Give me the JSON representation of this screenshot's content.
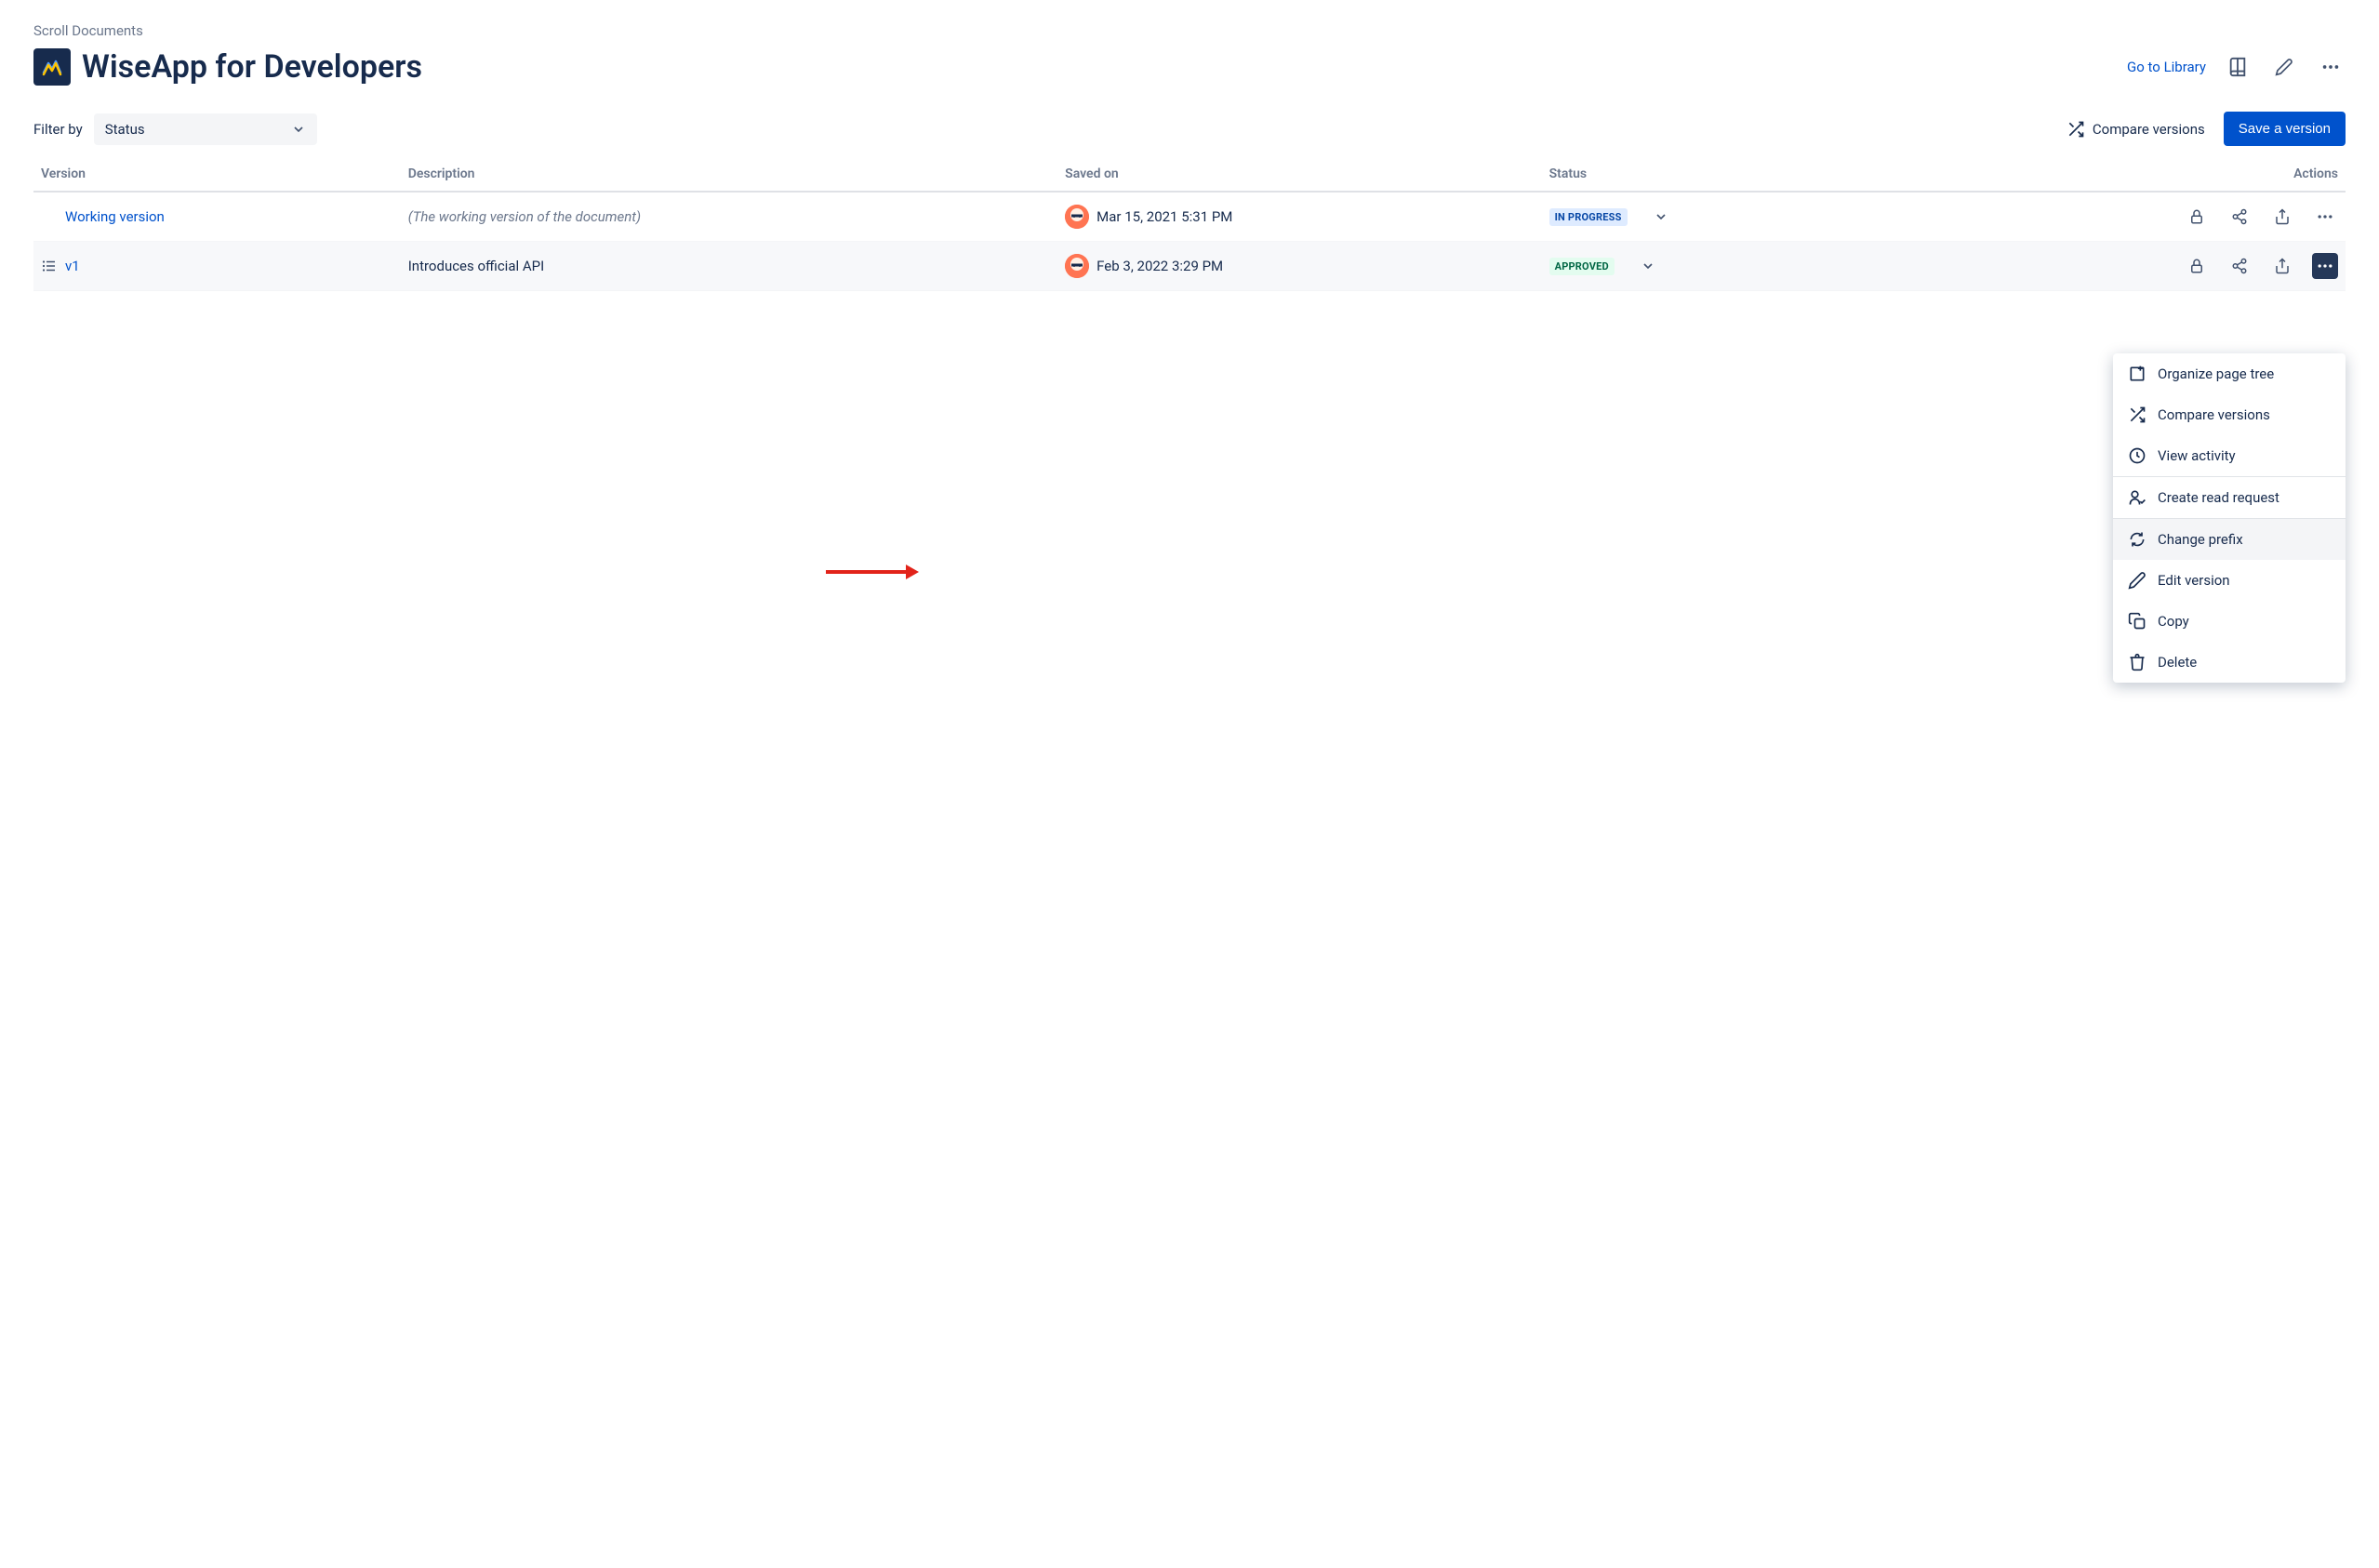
{
  "breadcrumb": "Scroll Documents",
  "page_title": "WiseApp for Developers",
  "header": {
    "go_to_library": "Go to Library"
  },
  "toolbar": {
    "filter_label": "Filter by",
    "status_select": "Status",
    "compare_label": "Compare versions",
    "save_label": "Save a version"
  },
  "table": {
    "headers": {
      "version": "Version",
      "description": "Description",
      "saved_on": "Saved on",
      "status": "Status",
      "actions": "Actions"
    },
    "rows": [
      {
        "version": "Working version",
        "description": "(The working version of the document)",
        "saved_on": "Mar 15, 2021 5:31 PM",
        "status": "IN PROGRESS"
      },
      {
        "version": "v1",
        "description": "Introduces official API",
        "saved_on": "Feb 3, 2022 3:29 PM",
        "status": "APPROVED"
      }
    ]
  },
  "dropdown": {
    "organize": "Organize page tree",
    "compare": "Compare versions",
    "activity": "View activity",
    "read_request": "Create read request",
    "change_prefix": "Change prefix",
    "edit_version": "Edit version",
    "copy": "Copy",
    "delete": "Delete"
  }
}
